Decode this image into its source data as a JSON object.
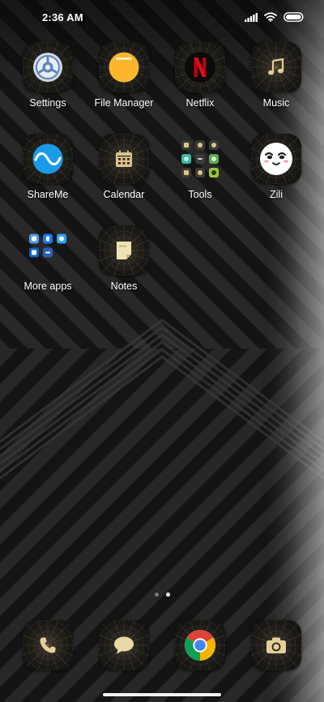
{
  "status_bar": {
    "time": "2:36 AM"
  },
  "apps": [
    {
      "label": "Settings",
      "icon": "settings-icon"
    },
    {
      "label": "File Manager",
      "icon": "file-manager-icon"
    },
    {
      "label": "Netflix",
      "icon": "netflix-icon"
    },
    {
      "label": "Music",
      "icon": "music-note-icon"
    },
    {
      "label": "ShareMe",
      "icon": "shareme-icon"
    },
    {
      "label": "Calendar",
      "icon": "calendar-icon"
    },
    {
      "label": "Tools",
      "icon": "tools-folder-icon"
    },
    {
      "label": "Zili",
      "icon": "zili-icon"
    },
    {
      "label": "More apps",
      "icon": "more-apps-folder-icon"
    },
    {
      "label": "Notes",
      "icon": "notes-icon"
    }
  ],
  "dock": [
    {
      "name": "phone",
      "icon": "phone-icon"
    },
    {
      "name": "messages",
      "icon": "message-bubble-icon"
    },
    {
      "name": "chrome",
      "icon": "chrome-icon"
    },
    {
      "name": "camera",
      "icon": "camera-icon"
    }
  ],
  "page_indicator": {
    "pages": 2,
    "current_page": 2
  },
  "colors": {
    "background": "#121212",
    "accent_gold": "#d9c48b",
    "netflix_red": "#e50914",
    "shareme_blue": "#1a9be8",
    "file_manager_orange": "#fdb52b"
  }
}
